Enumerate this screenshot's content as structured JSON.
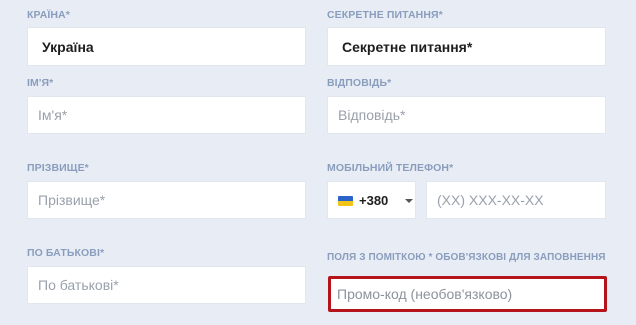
{
  "country": {
    "label": "КРАЇНА*",
    "value": "Україна"
  },
  "secret_question": {
    "label": "СЕКРЕТНЕ ПИТАННЯ*",
    "value": "Секретне питання*"
  },
  "first_name": {
    "label": "ІМ'Я*",
    "placeholder": "Ім'я*"
  },
  "answer": {
    "label": "ВІДПОВІДЬ*",
    "placeholder": "Відповідь*"
  },
  "last_name": {
    "label": "ПРІЗВИЩЕ*",
    "placeholder": "Прізвище*"
  },
  "mobile_phone": {
    "label": "МОБІЛЬНИЙ ТЕЛЕФОН*",
    "country_code": "+380",
    "flag_icon": "ukraine-flag-icon",
    "placeholder": "(XX) XXX-XX-XX"
  },
  "patronymic": {
    "label": "ПО БАТЬКОВІ*",
    "placeholder": "По батькові*"
  },
  "required_note": "ПОЛЯ З ПОМІТКОЮ * ОБОВ'ЯЗКОВІ ДЛЯ ЗАПОВНЕННЯ",
  "promo_code": {
    "placeholder": "Промо-код (необов'язково)"
  },
  "colors": {
    "background": "#e8edf5",
    "label": "#8a9dbd",
    "highlight_border": "#b5141b"
  }
}
